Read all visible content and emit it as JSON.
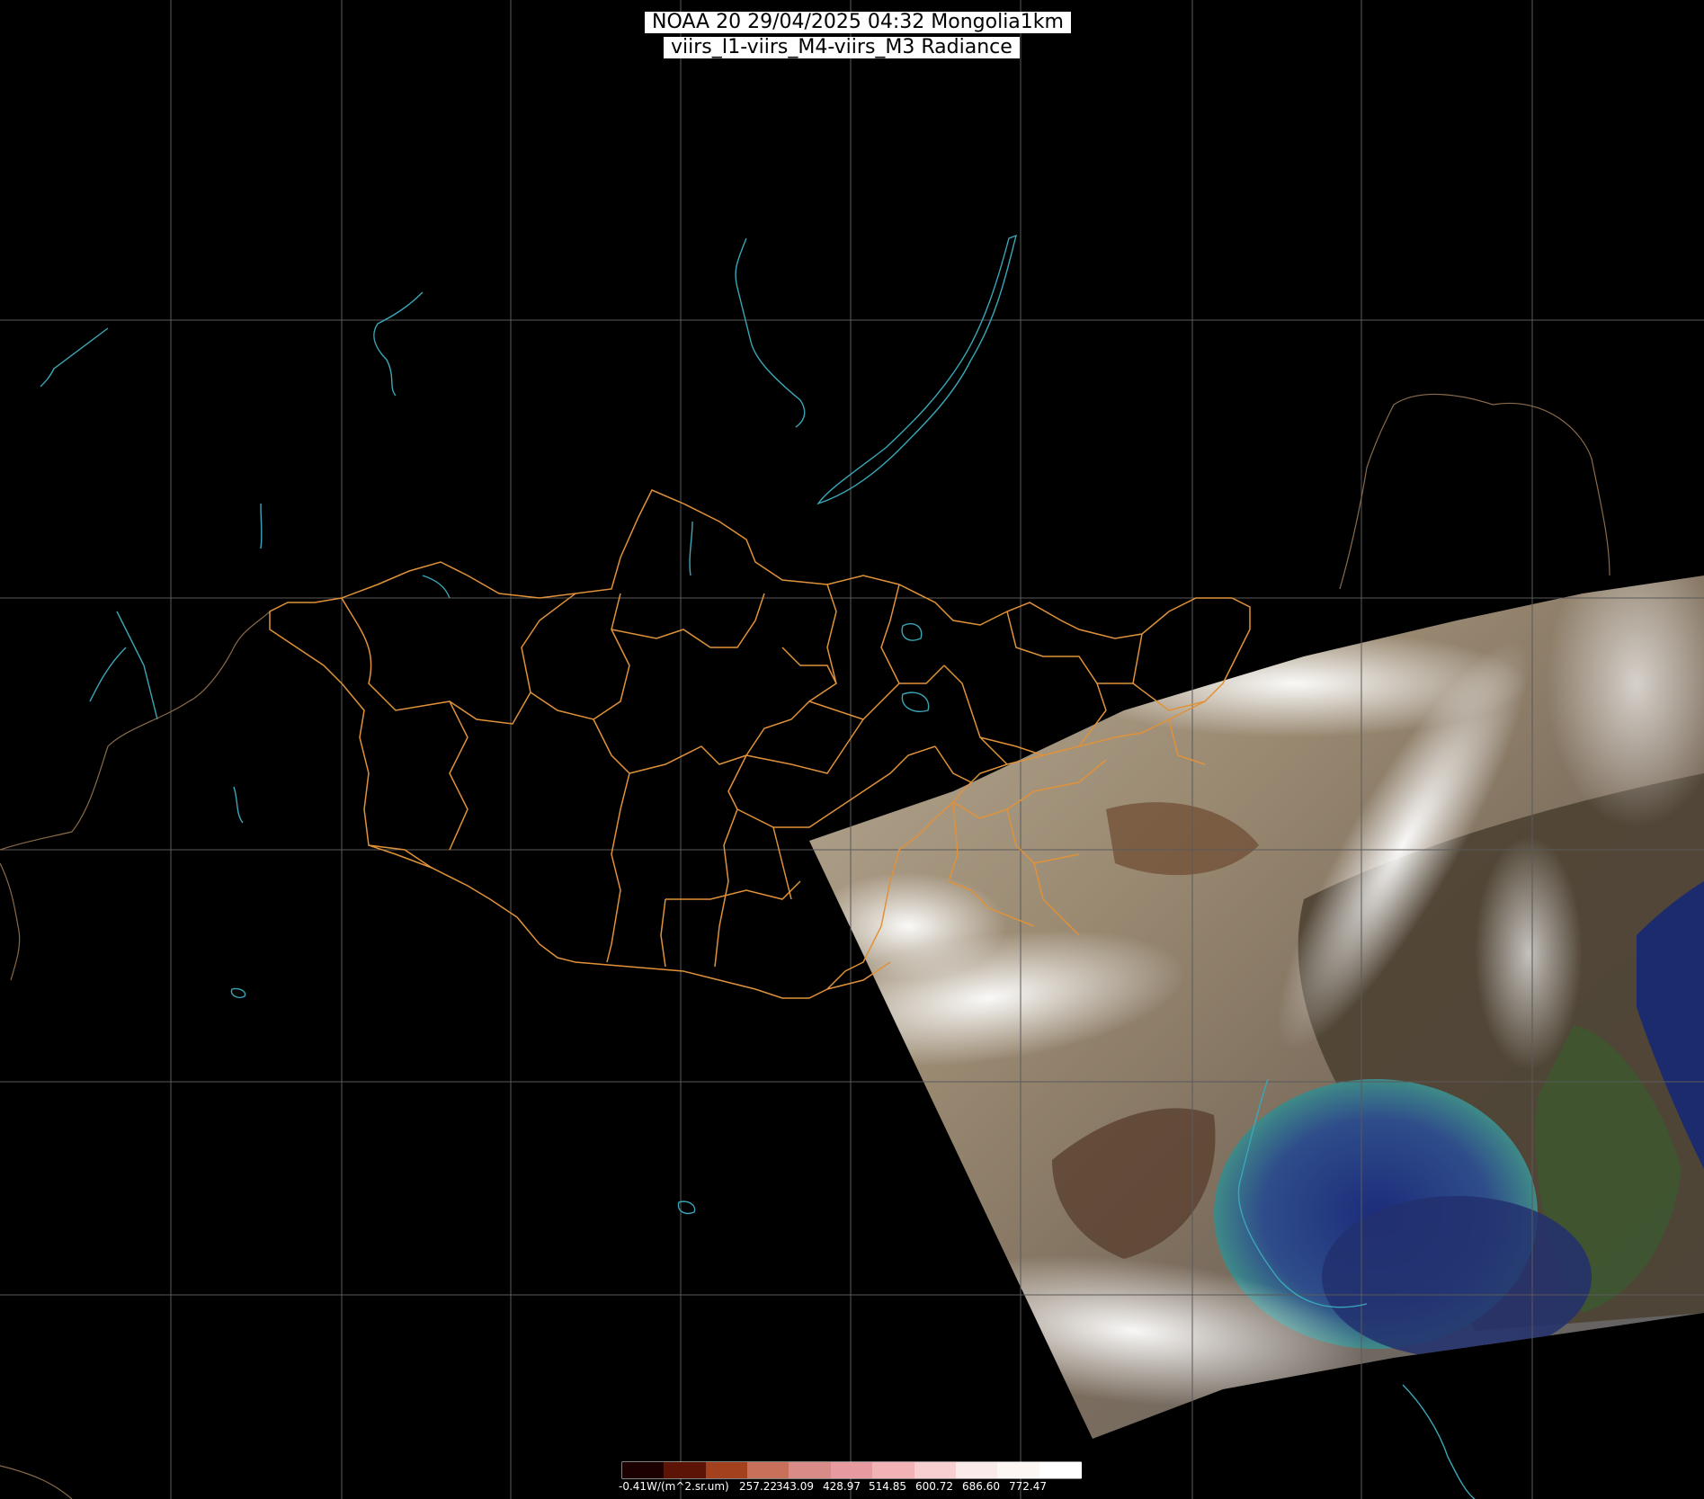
{
  "title": {
    "line1": "NOAA 20 29/04/2025 04:32 Mongolia1km",
    "line2": "viirs_I1-viirs_M4-viirs_M3 Radiance"
  },
  "colorbar": {
    "labels": [
      "-0.41W/(m^2.sr.um)",
      "257.22",
      "343.09",
      "428.97",
      "514.85",
      "600.72",
      "686.60",
      "772.47"
    ],
    "colors": [
      "#1a0000",
      "#5c1407",
      "#a3411e",
      "#c8705a",
      "#d98b88",
      "#e79ba0",
      "#f2b3b6",
      "#f7cfd1",
      "#faeaea",
      "#fdf7f3",
      "#ffffff"
    ]
  },
  "colors": {
    "background": "#000000",
    "grid": "#5a5a5a",
    "admin_borders": "#e0923a",
    "coastlines_lakes": "#3aa6b8",
    "international_borders": "#8a6a4a"
  }
}
